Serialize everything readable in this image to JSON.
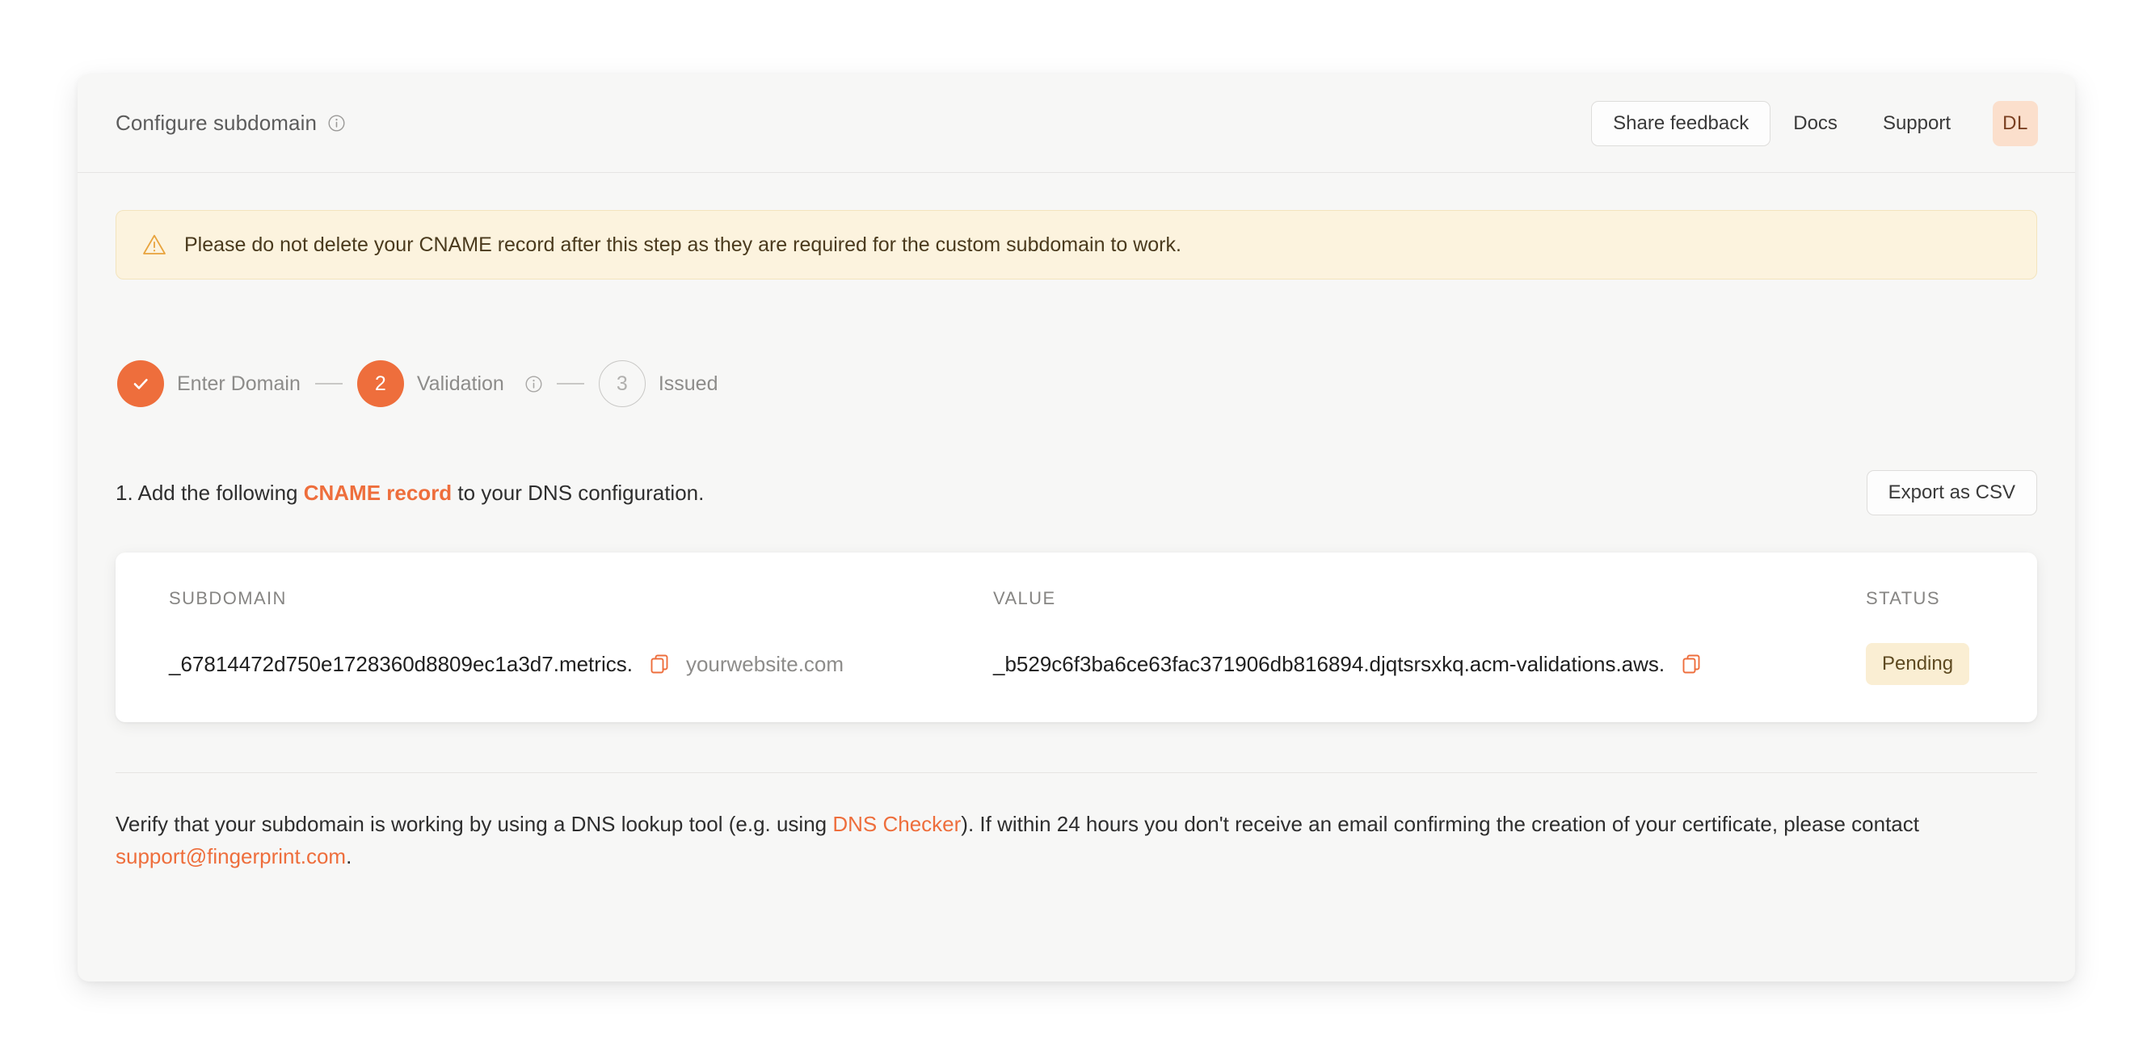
{
  "header": {
    "title": "Configure subdomain",
    "title_info_icon": "info-icon",
    "share_feedback_label": "Share feedback",
    "docs_label": "Docs",
    "support_label": "Support",
    "avatar_initials": "DL"
  },
  "warning": {
    "icon": "warning-triangle-icon",
    "message": "Please do not delete your CNAME record after this step as they are required for the custom subdomain to work."
  },
  "stepper": {
    "steps": [
      {
        "marker": "✓",
        "label": "Enter Domain",
        "state": "done"
      },
      {
        "marker": "2",
        "label": "Validation",
        "state": "active",
        "has_info_icon": true
      },
      {
        "marker": "3",
        "label": "Issued",
        "state": "todo"
      }
    ]
  },
  "instruction": {
    "prefix": "1. Add the following ",
    "accent": "CNAME record",
    "suffix": " to your DNS configuration.",
    "export_label": "Export as CSV"
  },
  "table": {
    "columns": [
      "SUBDOMAIN",
      "VALUE",
      "STATUS"
    ],
    "rows": [
      {
        "subdomain": "_67814472d750e1728360d8809ec1a3d7.metrics.",
        "subdomain_suffix": "yourwebsite.com",
        "value": "_b529c6f3ba6ce63fac371906db816894.djqtsrsxkq.acm-validations.aws.",
        "status": "Pending"
      }
    ]
  },
  "footer": {
    "part1": "Verify that your subdomain is working by using a DNS lookup tool (e.g. using ",
    "link1": "DNS Checker",
    "part2": "). If within 24 hours you don't receive an email confirming the creation of your certificate, please contact ",
    "link2": "support@fingerprint.com",
    "part3": "."
  },
  "colors": {
    "accent": "#ee6e3c",
    "panel_bg": "#f7f7f6",
    "warning_bg": "#fcf3de",
    "badge_bg": "#faeed3",
    "avatar_bg": "#fbdfcc"
  }
}
